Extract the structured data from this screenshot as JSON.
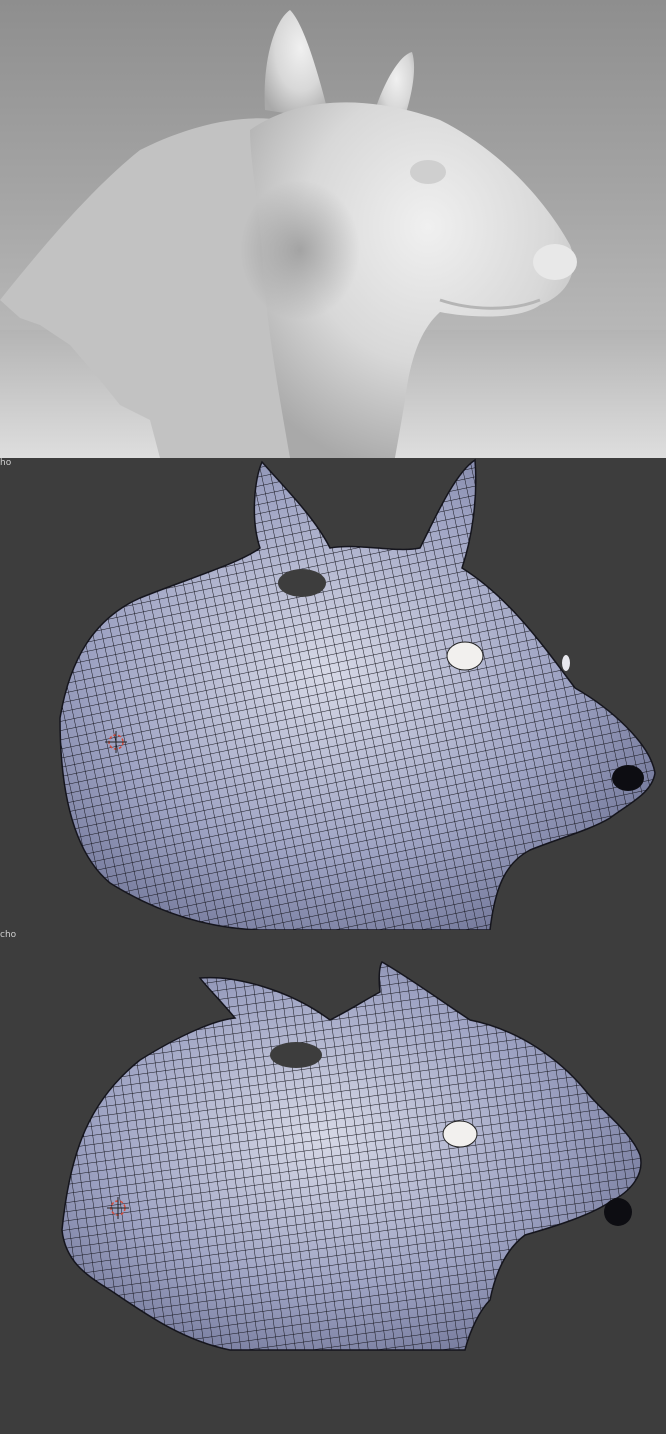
{
  "viewports": [
    {
      "label": "ho"
    },
    {
      "label": "cho"
    }
  ],
  "colors": {
    "render_background": "#a8a8a8",
    "clay_surface": "#dcdcdc",
    "viewport_background": "#3d3d3d",
    "mesh_fill": "#a5aac8",
    "wireframe": "#15151d",
    "eye_highlight": "#f2f0ee",
    "label_text": "#d0d0d0"
  },
  "icons": {
    "cursor": "3d-cursor-icon"
  }
}
